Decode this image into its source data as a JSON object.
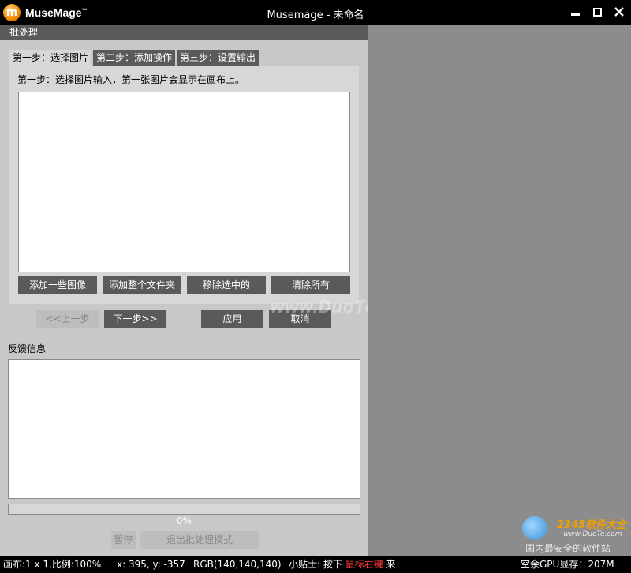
{
  "titlebar": {
    "logo_letter": "m",
    "app_name": "MuseMage",
    "trademark": "™",
    "title": "Musemage - 未命名"
  },
  "panel": {
    "header": "批处理",
    "tabs": [
      "第一步：选择图片",
      "第二步：添加操作",
      "第三步：设置输出"
    ],
    "step_desc": "第一步：选择图片输入，第一张图片会显示在画布上。",
    "buttons": {
      "add_images": "添加一些图像",
      "add_folder": "添加整个文件夹",
      "remove_selected": "移除选中的",
      "clear_all": "清除所有"
    },
    "nav": {
      "prev": "<<上一步",
      "next": "下一步>>",
      "apply": "应用",
      "cancel": "取消"
    },
    "feedback_label": "反馈信息",
    "progress_text": "0%",
    "progress_value": 0,
    "pause": "暂停",
    "exit_batch": "退出批处理模式"
  },
  "watermark": "www.DuoTe.com",
  "site_mark": {
    "brand": "2345软件大全",
    "url": "www.DuoTe.com",
    "tagline": "国内最安全的软件站"
  },
  "statusbar": {
    "canvas": "画布:1 x 1,比例:100%",
    "coords": "x: 395, y: -357",
    "rgb": "RGB(140,140,140)",
    "tip_prefix": "小贴士: 按下",
    "tip_key": "鼠标右键",
    "tip_suffix": "来",
    "gpu": "空余GPU显存：207M"
  },
  "colors": {
    "panel_bg": "#c8c8c8",
    "canvas_bg": "#8c8c8c",
    "button_bg": "#5a5a5a",
    "tip_highlight": "#ff3b3b"
  }
}
